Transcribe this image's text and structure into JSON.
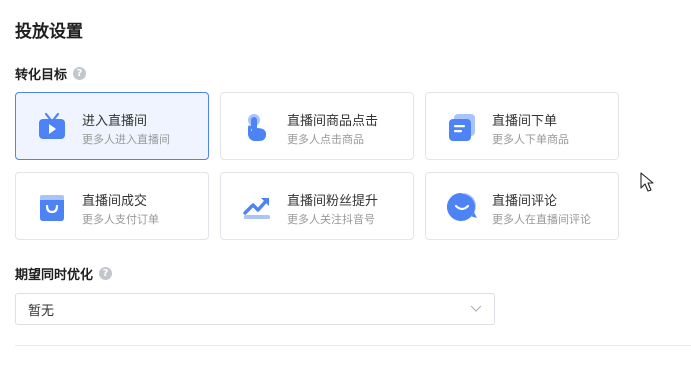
{
  "section": {
    "title": "投放设置"
  },
  "goal": {
    "label": "转化目标",
    "help_icon": "question-circle-icon",
    "options": [
      {
        "title": "进入直播间",
        "sub": "更多人进入直播间",
        "icon": "tv-icon",
        "selected": true
      },
      {
        "title": "直播间商品点击",
        "sub": "更多人点击商品",
        "icon": "tap-hand-icon",
        "selected": false
      },
      {
        "title": "直播间下单",
        "sub": "更多人下单商品",
        "icon": "order-list-icon",
        "selected": false
      },
      {
        "title": "直播间成交",
        "sub": "更多人支付订单",
        "icon": "shopping-bag-icon",
        "selected": false
      },
      {
        "title": "直播间粉丝提升",
        "sub": "更多人关注抖音号",
        "icon": "trend-up-icon",
        "selected": false
      },
      {
        "title": "直播间评论",
        "sub": "更多人在直播间评论",
        "icon": "chat-bubble-icon",
        "selected": false
      }
    ]
  },
  "optimize": {
    "label": "期望同时优化",
    "help_icon": "question-circle-icon",
    "value": "暂无"
  },
  "colors": {
    "accent": "#4e83f5",
    "selected_bg": "#eff4ff",
    "border": "#e3e5ea"
  }
}
